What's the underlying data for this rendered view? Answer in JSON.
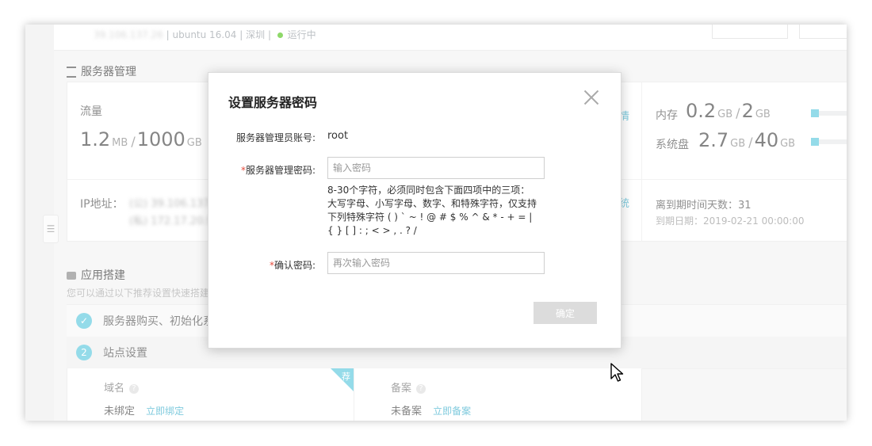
{
  "topbar": {
    "ip_blurred": "39.106.137.26",
    "os": "ubuntu 16.04",
    "sep": "|",
    "region": "深圳",
    "status": "运行中"
  },
  "server_mgmt": {
    "title": "服务器管理",
    "traffic_label": "流量",
    "traffic_used": "1.2",
    "traffic_used_unit": "MB",
    "traffic_total": "1000",
    "traffic_total_unit": "GB",
    "ip_label": "IP地址：",
    "ip_public_blurred": "(公) 39.106.137.2",
    "ip_private_blurred": "(私) 172.17.20.90",
    "memory_label": "内存",
    "memory_used": "0.2",
    "memory_used_unit": "GB",
    "memory_total": "2",
    "memory_total_unit": "GB",
    "memory_fraction": 0.1,
    "disk_label": "系统盘",
    "disk_used": "2.7",
    "disk_used_unit": "GB",
    "disk_total": "40",
    "disk_total_unit": "GB",
    "disk_fraction": 0.07,
    "slash": "/",
    "link_detail": "情",
    "link_system": "统",
    "days_label": "离到期时间天数：",
    "days_value": "31",
    "expire_label": "到期日期：",
    "expire_value": "2019-02-21 00:00:00"
  },
  "app_build": {
    "title": "应用搭建",
    "subtitle": "您可以通过以下推荐设置快速搭建",
    "step1_label": "服务器购买、初始化系",
    "step1_icon": "✓",
    "step2_num": "2",
    "step2_label": "站点设置",
    "ribbon": "荐",
    "domain_label": "域名",
    "domain_status": "未绑定",
    "domain_link": "立即绑定",
    "icp_label": "备案",
    "icp_status": "未备案",
    "icp_link": "立即备案",
    "help": "?"
  },
  "modal": {
    "title": "设置服务器密码",
    "account_label": "服务器管理员账号:",
    "account_value": "root",
    "required_mark": "*",
    "password_label": "服务器管理密码:",
    "password_placeholder": "输入密码",
    "hint": "8-30个字符，必须同时包含下面四项中的三项：大写字母、小写字母、数字、和特殊字符，仅支持下列特殊字符 ( ) ` ~ ! @ # $ % ^ & * - + = | { } [ ] : ; < > , . ? /",
    "confirm_label": "确认密码:",
    "confirm_placeholder": "再次输入密码",
    "confirm_button": "确定"
  },
  "colors": {
    "accent": "#5bc8de",
    "link": "#3aaecb",
    "required": "#e74c3c",
    "running": "#52c41a"
  }
}
